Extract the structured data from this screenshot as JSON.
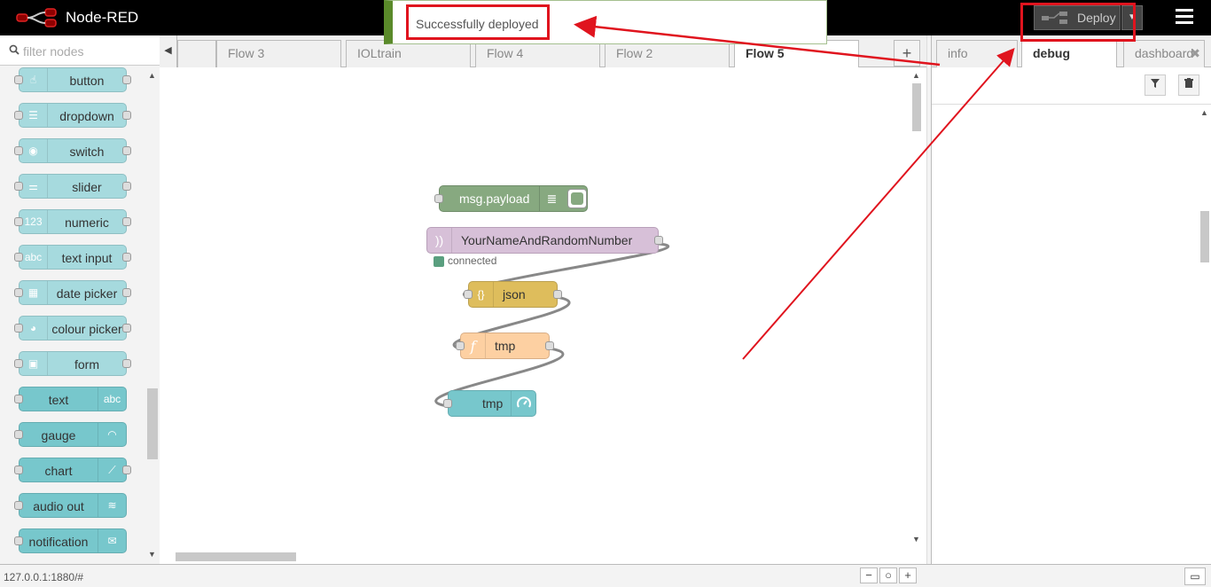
{
  "app": {
    "title": "Node-RED"
  },
  "header": {
    "deploy_label": "Deploy",
    "deploy_menu_icon": "caret-down-icon",
    "menu_icon": "hamburger-icon"
  },
  "notification": {
    "text": "Successfully deployed"
  },
  "palette": {
    "search_placeholder": "filter nodes",
    "nodes": [
      {
        "label": "button",
        "icon": "hand-icon",
        "style": "light"
      },
      {
        "label": "dropdown",
        "icon": "list-icon",
        "style": "light"
      },
      {
        "label": "switch",
        "icon": "toggle-icon",
        "style": "light"
      },
      {
        "label": "slider",
        "icon": "sliders-icon",
        "style": "light"
      },
      {
        "label": "numeric",
        "icon": "123-icon",
        "style": "light"
      },
      {
        "label": "text input",
        "icon": "abc-icon",
        "style": "light"
      },
      {
        "label": "date picker",
        "icon": "calendar-icon",
        "style": "light"
      },
      {
        "label": "colour picker",
        "icon": "palette-icon",
        "style": "light"
      },
      {
        "label": "form",
        "icon": "form-icon",
        "style": "light"
      },
      {
        "label": "text",
        "icon": "abc-icon",
        "style": "dark"
      },
      {
        "label": "gauge",
        "icon": "gauge-icon",
        "style": "dark"
      },
      {
        "label": "chart",
        "icon": "chart-icon",
        "style": "dark"
      },
      {
        "label": "audio out",
        "icon": "audio-icon",
        "style": "dark"
      },
      {
        "label": "notification",
        "icon": "envelope-icon",
        "style": "dark"
      }
    ]
  },
  "workspace": {
    "tabs": [
      "Flow 3",
      "IOLtrain",
      "Flow 4",
      "Flow 2",
      "Flow 5"
    ],
    "active_tab": "Flow 5",
    "add_flow_label": "+",
    "flow_nodes": {
      "debug": "msg.payload",
      "input": "YourNameAndRandomNumber",
      "input_status": "connected",
      "json": "json",
      "function": "tmp",
      "gauge": "tmp"
    }
  },
  "sidebar": {
    "tabs": [
      "info",
      "debug",
      "dashboard"
    ],
    "active_tab": "debug"
  },
  "footer": {
    "url": "127.0.0.1:1880/#",
    "zoom_out": "−",
    "zoom_reset": "○",
    "zoom_in": "+"
  },
  "colors": {
    "annotation": "#e0141e",
    "ui_node_light": "#a6dade",
    "ui_node_dark": "#77c7cc",
    "debug_node": "#87a980",
    "input_node": "#d7c0d8",
    "json_node": "#debd5c",
    "function_node": "#fdd0a2"
  }
}
